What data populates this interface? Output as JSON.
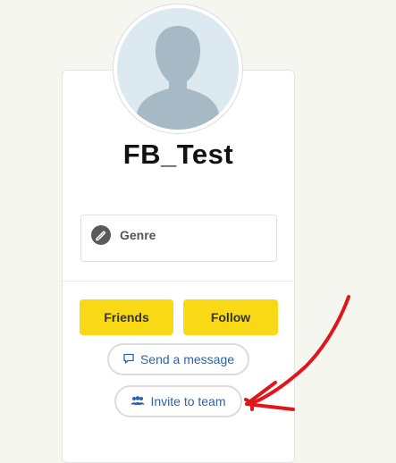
{
  "profile": {
    "username": "FB_Test",
    "genre_label": "Genre"
  },
  "actions": {
    "friends_label": "Friends",
    "follow_label": "Follow",
    "message_label": "Send a message",
    "invite_label": "Invite to team"
  },
  "icons": {
    "avatar": "default-avatar-icon",
    "genre": "pencil-icon",
    "message": "speech-bubble-icon",
    "invite": "people-icon",
    "annotation": "red-arrow-icon"
  },
  "colors": {
    "page_bg": "#f6f6f1",
    "button_yellow": "#f9d816",
    "link_blue": "#2f63a6",
    "arrow_red": "#e0161b"
  }
}
